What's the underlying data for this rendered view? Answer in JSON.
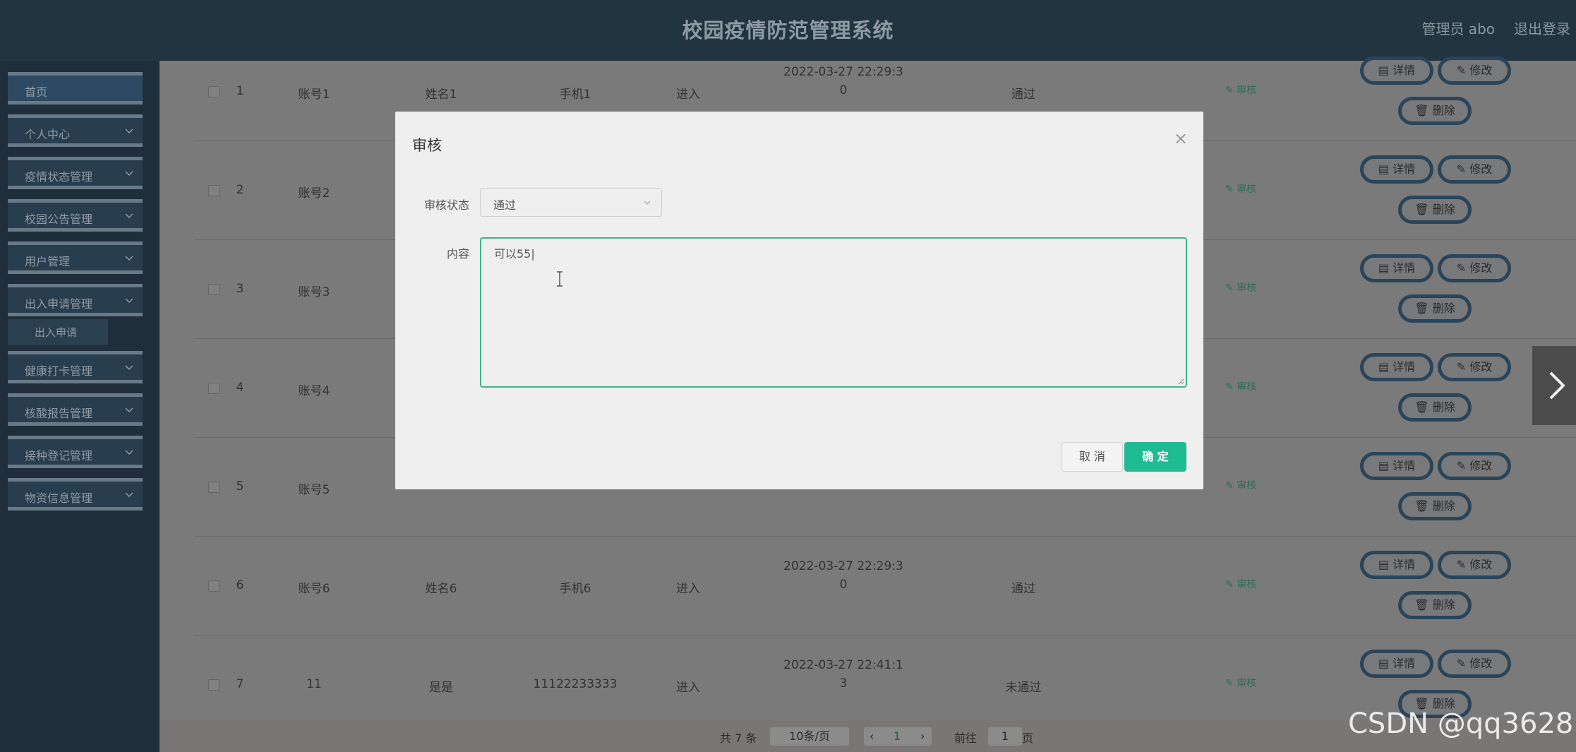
{
  "header": {
    "title": "校园疫情防范管理系统",
    "admin": "管理员 abo",
    "logout": "退出登录"
  },
  "sidebar": {
    "items": [
      {
        "label": "首页"
      },
      {
        "label": "个人中心"
      },
      {
        "label": "疫情状态管理"
      },
      {
        "label": "校园公告管理"
      },
      {
        "label": "用户管理"
      },
      {
        "label": "出入申请管理"
      },
      {
        "label": "健康打卡管理"
      },
      {
        "label": "核酸报告管理"
      },
      {
        "label": "接种登记管理"
      },
      {
        "label": "物资信息管理"
      }
    ],
    "subitem": {
      "label": "出入申请"
    }
  },
  "table": {
    "rows": [
      {
        "index": "1",
        "account": "账号1",
        "name": "姓名1",
        "phone": "手机1",
        "type": "进入",
        "time1": "2022-03-27 22:29:3",
        "time2": "0",
        "status": "通过"
      },
      {
        "index": "2",
        "account": "账号2"
      },
      {
        "index": "3",
        "account": "账号3"
      },
      {
        "index": "4",
        "account": "账号4"
      },
      {
        "index": "5",
        "account": "账号5"
      },
      {
        "index": "6",
        "account": "账号6",
        "name": "姓名6",
        "phone": "手机6",
        "type": "进入",
        "time1": "2022-03-27 22:29:3",
        "time2": "0",
        "status": "通过"
      },
      {
        "index": "7",
        "account": "11",
        "name": "是是",
        "phone": "11122233333",
        "type": "进入",
        "time1": "2022-03-27 22:41:1",
        "time2": "3",
        "status": "未通过"
      }
    ],
    "audit_label": "审核",
    "detail_label": "详情",
    "edit_label": "修改",
    "delete_label": "删除"
  },
  "pager": {
    "total": "共 7 条",
    "page_size": "10条/页",
    "current": "1",
    "goto_label": "前往",
    "goto_value": "1",
    "page_unit": "页"
  },
  "modal": {
    "title": "审核",
    "status_label": "审核状态",
    "status_value": "通过",
    "content_label": "内容",
    "content_value": "可以55|",
    "cancel": "取 消",
    "ok": "确 定"
  },
  "watermark": "CSDN @qq3628"
}
